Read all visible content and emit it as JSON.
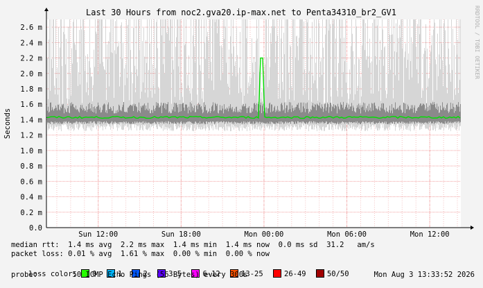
{
  "chart_data": {
    "type": "line",
    "title": "Last 30 Hours from noc2.gva20.ip-max.net to Penta34310_br2_GV1",
    "ylabel": "Seconds",
    "watermark": "RRDTOOL / TOBI OETIKER",
    "y_ticks": [
      "0.0",
      "0.2 m",
      "0.4 m",
      "0.6 m",
      "0.8 m",
      "1.0 m",
      "1.2 m",
      "1.4 m",
      "1.6 m",
      "1.8 m",
      "2.0 m",
      "2.2 m",
      "2.4 m",
      "2.6 m"
    ],
    "ylim_ms": [
      0,
      2.7
    ],
    "x_ticks": [
      {
        "label": "Sun 12:00",
        "hour": 3.75
      },
      {
        "label": "Sun 18:00",
        "hour": 9.75
      },
      {
        "label": "Mon 00:00",
        "hour": 15.75
      },
      {
        "label": "Mon 06:00",
        "hour": 21.75
      },
      {
        "label": "Mon 12:00",
        "hour": 27.75
      }
    ],
    "xlim_hours": [
      0,
      30
    ],
    "grid": true,
    "series": [
      {
        "name": "median rtt",
        "color": "#00e000",
        "baseline_ms": 1.43,
        "peaks": [
          {
            "hour": 15.6,
            "ms": 2.2
          }
        ]
      }
    ]
  },
  "legend": {
    "median_rtt": "median rtt:  1.4 ms avg  2.2 ms max  1.4 ms min  1.4 ms now  0.0 ms sd  31.2   am/s",
    "packet_loss": "packet loss: 0.01 % avg  1.61 % max  0.00 % min  0.00 % now",
    "loss_color_label": "loss color:",
    "loss_colors": [
      {
        "label": "0",
        "color": "#26ff00"
      },
      {
        "label": "1",
        "color": "#00b8ff"
      },
      {
        "label": "2",
        "color": "#0059ff"
      },
      {
        "label": "3-5",
        "color": "#5e00ff"
      },
      {
        "label": "6-12",
        "color": "#ff00ff"
      },
      {
        "label": "13-25",
        "color": "#ff5500"
      },
      {
        "label": "26-49",
        "color": "#ff0000"
      },
      {
        "label": "50/50",
        "color": "#a10000"
      }
    ],
    "probe": "probe:        50 ICMP Echo Pings (56 Bytes) every 300s",
    "date": "Mon Aug  3 13:33:52 2026"
  }
}
